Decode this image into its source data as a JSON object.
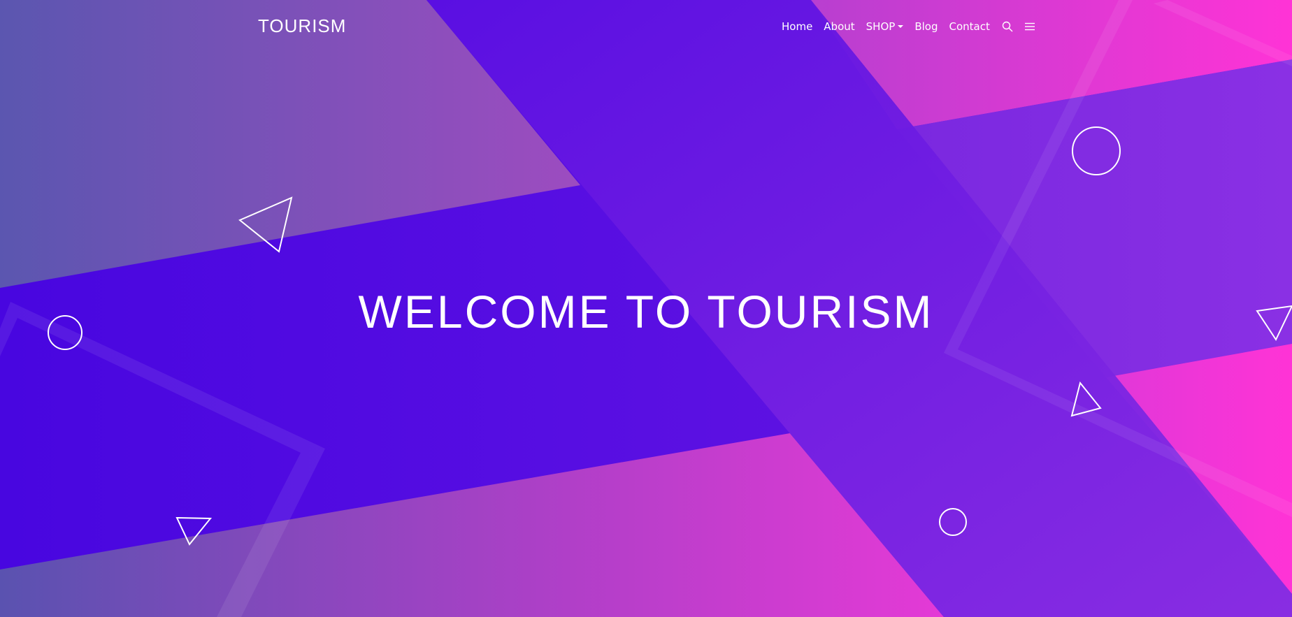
{
  "brand": {
    "name": "TOURISM"
  },
  "nav": {
    "items": [
      {
        "label": "Home"
      },
      {
        "label": "About"
      },
      {
        "label": "SHOP"
      },
      {
        "label": "Blog"
      },
      {
        "label": "Contact"
      }
    ],
    "search_icon": "search-icon",
    "menu_icon": "hamburger-menu-icon"
  },
  "hero": {
    "title": "WELCOME TO TOURISM"
  },
  "colors": {
    "deep_violet": "#4a0be0",
    "purple": "#7a22e0",
    "magenta": "#ff33d6",
    "slate_purple": "#5a55b0",
    "text": "#ffffff"
  }
}
